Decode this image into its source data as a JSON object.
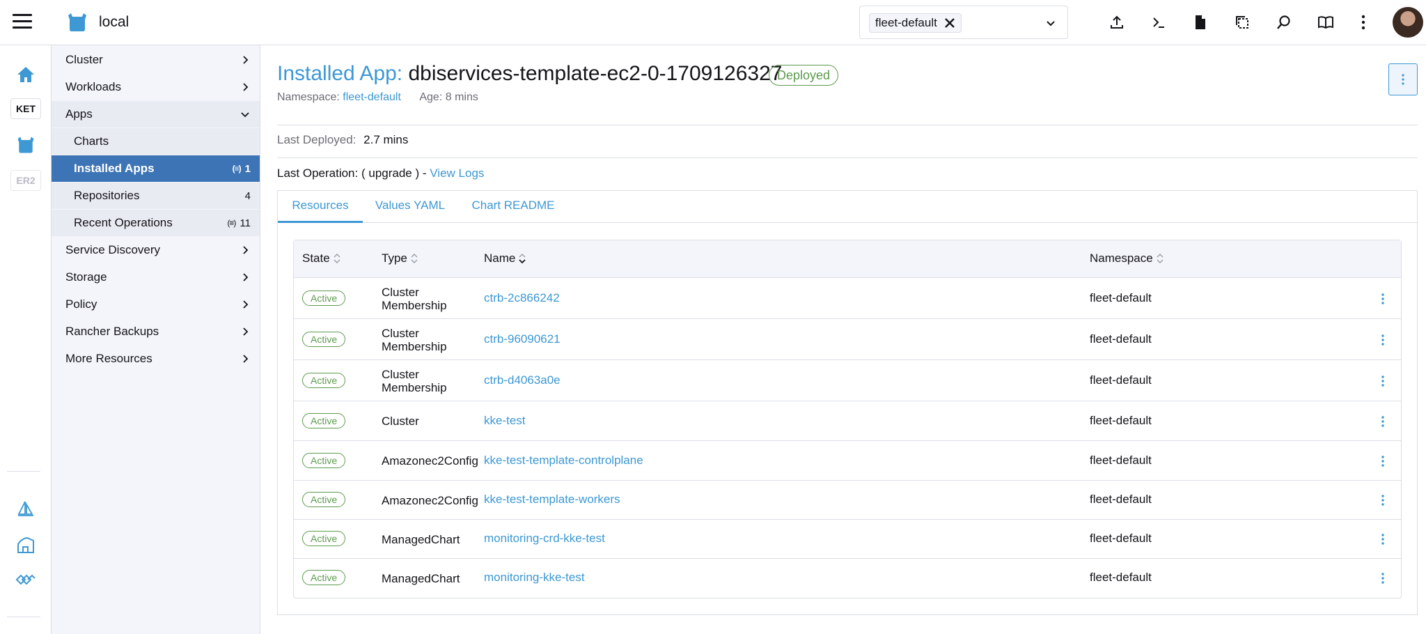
{
  "header": {
    "cluster_name": "local",
    "namespace_filter": "fleet-default"
  },
  "rail": {
    "badges": [
      "KET",
      "ER2"
    ]
  },
  "sidenav": {
    "items": [
      {
        "label": "Cluster"
      },
      {
        "label": "Workloads"
      },
      {
        "label": "Apps"
      },
      {
        "label": "Charts"
      },
      {
        "label": "Installed Apps",
        "count": "1"
      },
      {
        "label": "Repositories",
        "count": "4"
      },
      {
        "label": "Recent Operations",
        "count": "11"
      },
      {
        "label": "Service Discovery"
      },
      {
        "label": "Storage"
      },
      {
        "label": "Policy"
      },
      {
        "label": "Rancher Backups"
      },
      {
        "label": "More Resources"
      }
    ]
  },
  "page": {
    "title_label": "Installed App:",
    "title_name": "dbiservices-template-ec2-0-1709126327",
    "status": "Deployed",
    "namespace_label": "Namespace:",
    "namespace_value": "fleet-default",
    "age_label": "Age:",
    "age_value": "8 mins",
    "last_deployed_label": "Last Deployed:",
    "last_deployed_value": "2.7 mins",
    "last_operation_label": "Last Operation:",
    "last_operation_value": "( upgrade ) -",
    "view_logs": "View Logs"
  },
  "tabs": [
    "Resources",
    "Values YAML",
    "Chart README"
  ],
  "table": {
    "headers": [
      "State",
      "Type",
      "Name",
      "Namespace"
    ],
    "rows": [
      {
        "state": "Active",
        "type": "Cluster Membership",
        "name": "ctrb-2c866242",
        "namespace": "fleet-default"
      },
      {
        "state": "Active",
        "type": "Cluster Membership",
        "name": "ctrb-96090621",
        "namespace": "fleet-default"
      },
      {
        "state": "Active",
        "type": "Cluster Membership",
        "name": "ctrb-d4063a0e",
        "namespace": "fleet-default"
      },
      {
        "state": "Active",
        "type": "Cluster",
        "name": "kke-test",
        "namespace": "fleet-default"
      },
      {
        "state": "Active",
        "type": "Amazonec2Config",
        "name": "kke-test-template-controlplane",
        "namespace": "fleet-default"
      },
      {
        "state": "Active",
        "type": "Amazonec2Config",
        "name": "kke-test-template-workers",
        "namespace": "fleet-default"
      },
      {
        "state": "Active",
        "type": "ManagedChart",
        "name": "monitoring-crd-kke-test",
        "namespace": "fleet-default"
      },
      {
        "state": "Active",
        "type": "ManagedChart",
        "name": "monitoring-kke-test",
        "namespace": "fleet-default"
      }
    ]
  },
  "colors": {
    "accent": "#3d98d3",
    "active_nav": "#3d74b5",
    "success": "#5c9a4d"
  }
}
